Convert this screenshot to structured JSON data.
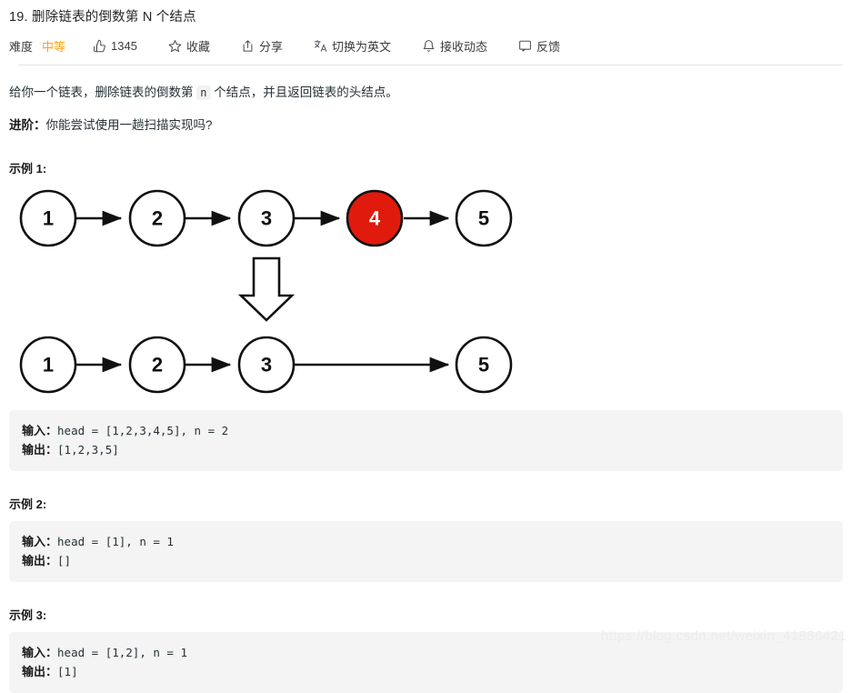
{
  "header": {
    "title": "19. 删除链表的倒数第 N 个结点",
    "difficulty_label": "难度",
    "difficulty_value": "中等",
    "difficulty_color": "#ffa116",
    "actions": [
      {
        "icon": "thumbs-up-icon",
        "label": "1345"
      },
      {
        "icon": "star-icon",
        "label": "收藏"
      },
      {
        "icon": "share-icon",
        "label": "分享"
      },
      {
        "icon": "translate-icon",
        "label": "切换为英文"
      },
      {
        "icon": "bell-icon",
        "label": "接收动态"
      },
      {
        "icon": "feedback-icon",
        "label": "反馈"
      }
    ]
  },
  "description": {
    "prompt_before": "给你一个链表，删除链表的倒数第 ",
    "prompt_code": "n",
    "prompt_after": " 个结点，并且返回链表的头结点。",
    "follow_up_label": "进阶：",
    "follow_up_text": "你能尝试使用一趟扫描实现吗?"
  },
  "examples": [
    {
      "title": "示例 1:",
      "input_label": "输入：",
      "input_value": "head = [1,2,3,4,5], n = 2",
      "output_label": "输出：",
      "output_value": "[1,2,3,5]"
    },
    {
      "title": "示例 2:",
      "input_label": "输入：",
      "input_value": "head = [1], n = 1",
      "output_label": "输出：",
      "output_value": "[]"
    },
    {
      "title": "示例 3:",
      "input_label": "输入：",
      "input_value": "head = [1,2], n = 1",
      "output_label": "输出：",
      "output_value": "[1]"
    }
  ],
  "diagram": {
    "highlight_color": "#e01b0d",
    "node_stroke": "#111111",
    "node_fill": "#ffffff",
    "before_nodes": [
      {
        "value": "1",
        "highlighted": false
      },
      {
        "value": "2",
        "highlighted": false
      },
      {
        "value": "3",
        "highlighted": false
      },
      {
        "value": "4",
        "highlighted": true
      },
      {
        "value": "5",
        "highlighted": false
      }
    ],
    "after_nodes": [
      {
        "value": "1",
        "highlighted": false
      },
      {
        "value": "2",
        "highlighted": false
      },
      {
        "value": "3",
        "highlighted": false
      },
      {
        "value": "5",
        "highlighted": false
      }
    ],
    "transition_icon": "down-arrow-icon"
  },
  "watermark": "https://blog.csdn.net/weixin_41886421"
}
